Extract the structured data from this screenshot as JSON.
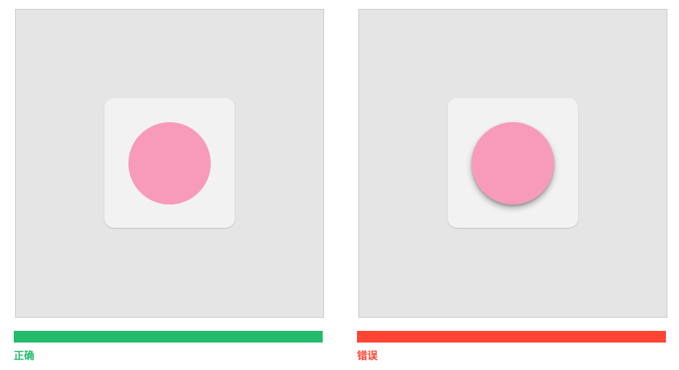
{
  "examples": [
    {
      "label": "正确",
      "status_color": "#22bb6c",
      "circle_shadow": false
    },
    {
      "label": "错误",
      "status_color": "#ff4433",
      "circle_shadow": true
    }
  ],
  "colors": {
    "panel_background": "#e5e5e5",
    "tile_background": "#f2f2f2",
    "circle_fill": "#f89bbb"
  }
}
